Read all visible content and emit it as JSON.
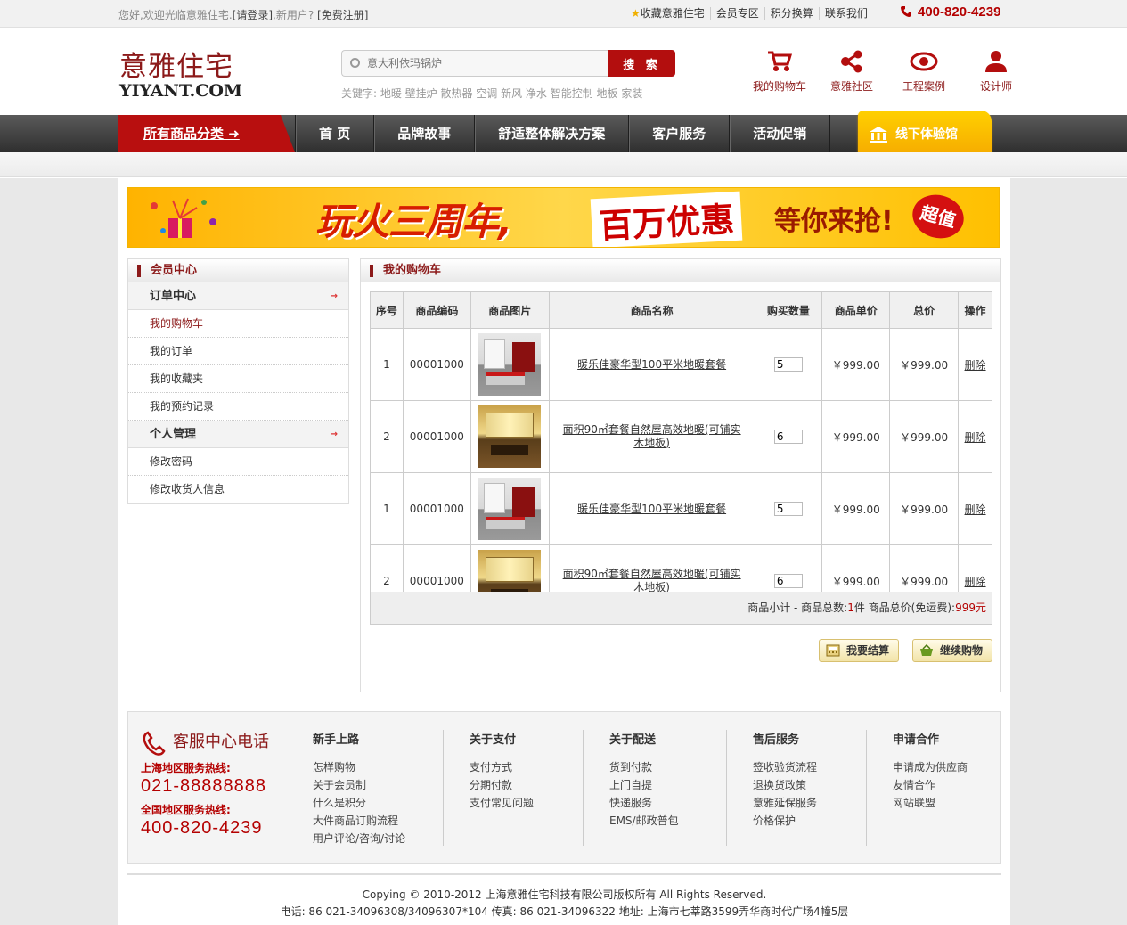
{
  "topbar": {
    "welcome": "您好,欢迎光临意雅住宅.",
    "login": "[请登录]",
    "new_user": ",新用户?",
    "register": "[免费注册]",
    "links": [
      "收藏意雅住宅",
      "会员专区",
      "积分换算",
      "联系我们"
    ],
    "phone": "400-820-4239"
  },
  "header": {
    "logo_cn": "意雅住宅",
    "logo_en": "YIYANT.COM",
    "search_placeholder": "意大利依玛锅炉",
    "search_button": "搜 索",
    "keywords": "关键字: 地暖 壁挂炉 散热器 空调 新风 净水 智能控制 地板 家装",
    "icons": [
      {
        "label": "我的购物车",
        "icon": "cart-icon"
      },
      {
        "label": "意雅社区",
        "icon": "share-icon"
      },
      {
        "label": "工程案例",
        "icon": "eye-icon"
      },
      {
        "label": "设计师",
        "icon": "user-icon"
      }
    ]
  },
  "nav": {
    "all_categories": "所有商品分类 ➜",
    "items": [
      "首 页",
      "品牌故事",
      "舒适整体解决方案",
      "客户服务",
      "活动促销"
    ],
    "experience": "线下体验馆"
  },
  "banner": {
    "text1": "玩火三周年,",
    "text2": "百万优惠",
    "text3": "等你来抢!",
    "badge": "超值"
  },
  "sidebar": {
    "title": "会员中心",
    "sections": [
      {
        "head": "订单中心",
        "items": [
          "我的购物车",
          "我的订单",
          "我的收藏夹",
          "我的预约记录"
        ]
      },
      {
        "head": "个人管理",
        "items": [
          "修改密码",
          "修改收货人信息"
        ]
      }
    ]
  },
  "cart": {
    "title": "我的购物车",
    "columns": [
      "序号",
      "商品编码",
      "商品图片",
      "商品名称",
      "购买数量",
      "商品单价",
      "总价",
      "操作"
    ],
    "rows": [
      {
        "no": "1",
        "code": "00001000",
        "img": "a",
        "name": "暖乐佳豪华型100平米地暖套餐",
        "qty": "5",
        "price": "￥999.00",
        "total": "￥999.00",
        "op": "删除"
      },
      {
        "no": "2",
        "code": "00001000",
        "img": "b",
        "name": "面积90㎡套餐自然屋高效地暖(可铺实木地板)",
        "qty": "6",
        "price": "￥999.00",
        "total": "￥999.00",
        "op": "删除"
      },
      {
        "no": "1",
        "code": "00001000",
        "img": "a",
        "name": "暖乐佳豪华型100平米地暖套餐",
        "qty": "5",
        "price": "￥999.00",
        "total": "￥999.00",
        "op": "删除"
      },
      {
        "no": "2",
        "code": "00001000",
        "img": "b",
        "name": "面积90㎡套餐自然屋高效地暖(可铺实木地板)",
        "qty": "6",
        "price": "￥999.00",
        "total": "￥999.00",
        "op": "删除"
      }
    ],
    "subtotal_prefix": "商品小计 - 商品总数:",
    "subtotal_count": "1",
    "subtotal_mid": "件 商品总价(免运费):",
    "subtotal_amount": "999元",
    "checkout": "我要结算",
    "continue": "继续购物"
  },
  "footer": {
    "hotline_title": "客服中心电话",
    "shanghai_label": "上海地区服务热线:",
    "shanghai_num": "021-88888888",
    "national_label": "全国地区服务热线:",
    "national_num": "400-820-4239",
    "columns": [
      {
        "head": "新手上路",
        "links": [
          "怎样购物",
          "关于会员制",
          "什么是积分",
          "大件商品订购流程",
          "用户评论/咨询/讨论"
        ]
      },
      {
        "head": "关于支付",
        "links": [
          "支付方式",
          "分期付款",
          "支付常见问题"
        ]
      },
      {
        "head": "关于配送",
        "links": [
          "货到付款",
          "上门自提",
          "快递服务",
          "EMS/邮政普包"
        ]
      },
      {
        "head": "售后服务",
        "links": [
          "签收验货流程",
          "退换货政策",
          "意雅延保服务",
          "价格保护"
        ]
      },
      {
        "head": "申请合作",
        "links": [
          "申请成为供应商",
          "友情合作",
          "网站联盟"
        ]
      }
    ],
    "copyright": "Copying © 2010-2012 上海意雅住宅科技有限公司版权所有 All Rights Reserved.",
    "contact": "电话: 86 021-34096308/34096307*104 传真: 86 021-34096322 地址: 上海市七莘路3599弄华商时代广场4幢5层"
  },
  "colors": {
    "brand_red": "#b30e0e",
    "dark_red": "#8c1a1a",
    "accent_yellow": "#f5a800"
  }
}
